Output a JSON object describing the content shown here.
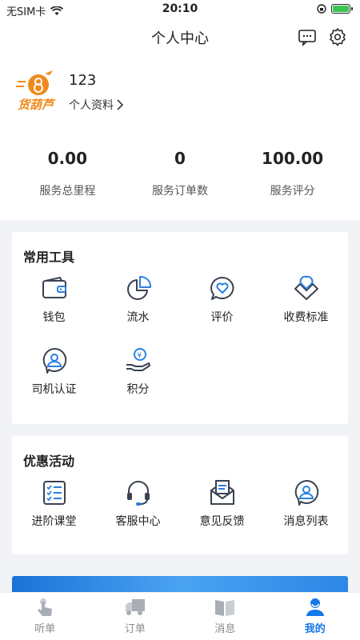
{
  "status_bar": {
    "carrier": "无SIM卡",
    "time": "20:10"
  },
  "header": {
    "title": "个人中心"
  },
  "profile": {
    "name": "123",
    "link_label": "个人资料",
    "logo_text": "货葫芦"
  },
  "stats": [
    {
      "value": "0.00",
      "label": "服务总里程"
    },
    {
      "value": "0",
      "label": "服务订单数"
    },
    {
      "value": "100.00",
      "label": "服务评分"
    }
  ],
  "tools": {
    "title": "常用工具",
    "items": [
      {
        "label": "钱包",
        "icon": "wallet-icon"
      },
      {
        "label": "流水",
        "icon": "pie-chart-icon"
      },
      {
        "label": "评价",
        "icon": "heart-chat-icon"
      },
      {
        "label": "收费标准",
        "icon": "location-pin-icon"
      },
      {
        "label": "司机认证",
        "icon": "driver-badge-icon"
      },
      {
        "label": "积分",
        "icon": "coin-hand-icon"
      }
    ]
  },
  "activities": {
    "title": "优惠活动",
    "items": [
      {
        "label": "进阶课堂",
        "icon": "checklist-icon"
      },
      {
        "label": "客服中心",
        "icon": "headset-icon"
      },
      {
        "label": "意见反馈",
        "icon": "envelope-icon"
      },
      {
        "label": "消息列表",
        "icon": "message-badge-icon"
      }
    ]
  },
  "tabbar": [
    {
      "label": "听单",
      "icon": "hand-tap-icon",
      "active": false
    },
    {
      "label": "订单",
      "icon": "truck-icon",
      "active": false
    },
    {
      "label": "消息",
      "icon": "book-icon",
      "active": false
    },
    {
      "label": "我的",
      "icon": "person-icon",
      "active": true
    }
  ],
  "colors": {
    "accent": "#1677e8",
    "icon_blue": "#2b7fe0",
    "icon_dark": "#3a4250"
  }
}
